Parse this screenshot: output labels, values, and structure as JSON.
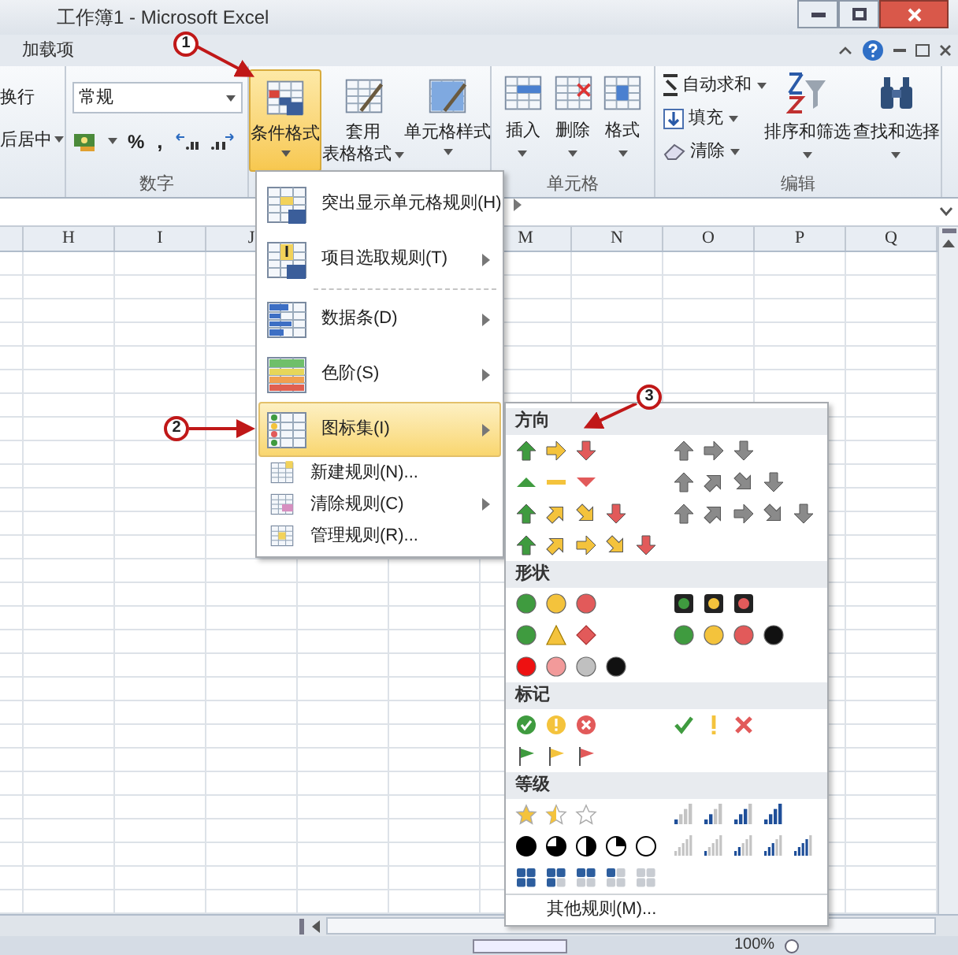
{
  "window": {
    "title": "工作簿1 - Microsoft Excel"
  },
  "ribbon_tabs": [
    {
      "label": "加载项",
      "selected": false
    }
  ],
  "ribbon": {
    "alignment": {
      "wrap": "换行",
      "merge": "后居中"
    },
    "number": {
      "format": "常规",
      "percent": "%",
      "comma": ",",
      "label": "数字"
    },
    "styles": [
      {
        "label": "条件格式",
        "selected": true
      },
      {
        "label": "套用",
        "label_2": "表格格式",
        "selected": false
      },
      {
        "label": "单元格样式",
        "selected": false
      }
    ],
    "cells": {
      "buttons": [
        "插入",
        "删除",
        "格式"
      ],
      "label": "单元格"
    },
    "editing": {
      "commands": [
        "自动求和",
        "填充",
        "清除"
      ],
      "buttons": [
        "排序和筛选",
        "查找和选择"
      ],
      "label": "编辑"
    }
  },
  "columns_left": [
    "H",
    "I",
    "J"
  ],
  "columns_right": [
    "M",
    "N",
    "O",
    "P",
    "Q"
  ],
  "menu": {
    "items": [
      {
        "kind": "large",
        "label": "突出显示单元格规则(H)",
        "submenu": true,
        "selected": false
      },
      {
        "kind": "large",
        "label": "项目选取规则(T)",
        "submenu": true,
        "selected": false
      },
      {
        "kind": "large",
        "label": "数据条(D)",
        "submenu": true,
        "selected": false
      },
      {
        "kind": "large",
        "label": "色阶(S)",
        "submenu": true,
        "selected": false
      },
      {
        "kind": "large",
        "label": "图标集(I)",
        "submenu": true,
        "selected": true
      },
      {
        "kind": "small",
        "label": "新建规则(N)...",
        "submenu": false,
        "selected": false
      },
      {
        "kind": "small",
        "label": "清除规则(C)",
        "submenu": true,
        "selected": false
      },
      {
        "kind": "small",
        "label": "管理规则(R)...",
        "submenu": false,
        "selected": false
      }
    ]
  },
  "icon_sets": {
    "sections": [
      {
        "title": "方向"
      },
      {
        "title": "形状"
      },
      {
        "title": "标记"
      },
      {
        "title": "等级"
      }
    ],
    "more": "其他规则(M)..."
  },
  "callouts": [
    "1",
    "2",
    "3"
  ],
  "status_bar": {
    "zoom": "100%"
  }
}
